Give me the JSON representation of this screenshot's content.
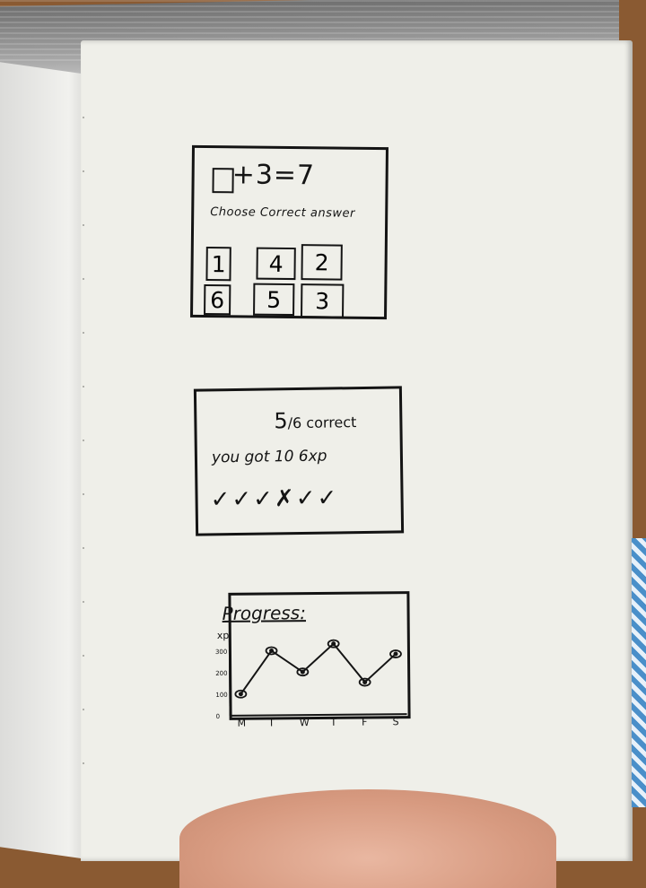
{
  "card1": {
    "equation": "+3=7",
    "prompt": "Choose Correct answer",
    "options": [
      "1",
      "4",
      "2",
      "6",
      "5",
      "3"
    ]
  },
  "card2": {
    "score_num": "5",
    "score_den": "6",
    "score_label": "correct",
    "xp_text": "you got 10 6xp",
    "marks": "✓✓✓✗✓✓"
  },
  "card3": {
    "title": "Progress:",
    "ylabel": "xp",
    "chart_data": {
      "type": "line",
      "title": "Progress:",
      "ylabel": "xp",
      "xlabel": "",
      "x_ticks": [
        "M",
        "T",
        "W",
        "T",
        "F",
        "S"
      ],
      "y_ticks": [
        "0",
        "100",
        "200",
        "300"
      ],
      "ylim": [
        0,
        350
      ],
      "series": [
        {
          "x": [
            "M",
            "T",
            "W",
            "T",
            "F",
            "S"
          ],
          "values": [
            100,
            300,
            200,
            330,
            150,
            280
          ]
        }
      ]
    }
  }
}
